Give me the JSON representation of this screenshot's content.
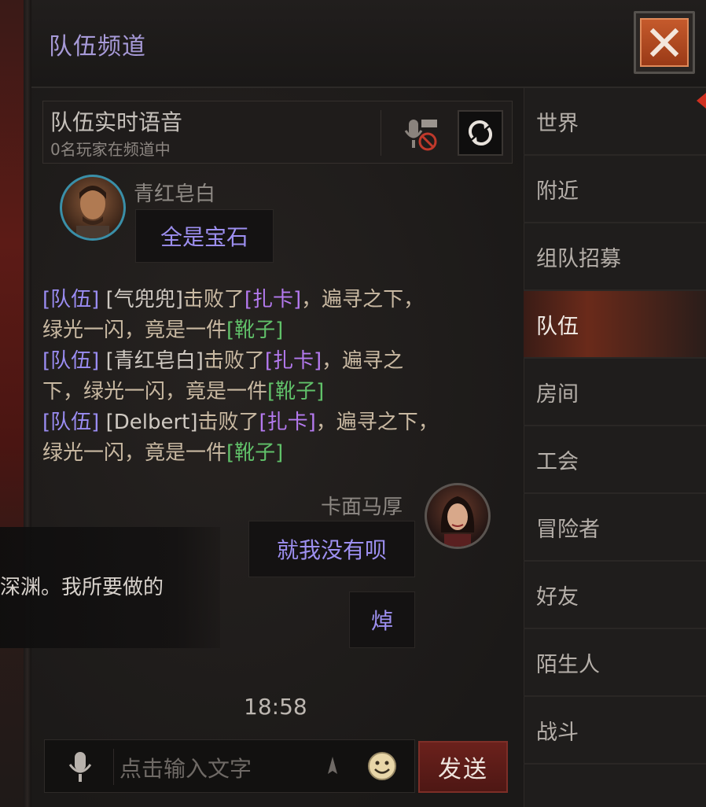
{
  "header": {
    "title": "队伍频道",
    "close_icon": "close-icon"
  },
  "voice": {
    "title": "队伍实时语音",
    "status": "0名玩家在频道中",
    "mic_icon": "mic-muted-icon",
    "refresh_icon": "refresh-icon"
  },
  "messages": {
    "left_player": {
      "name": "青红皂白",
      "text": "全是宝石"
    },
    "system": [
      {
        "channel": "[队伍]",
        "player": "[气兜兜]",
        "verb": "击败了",
        "target": "[扎卡]",
        "mid": "，遍寻之下，",
        "mid2": "绿光一闪，竟是一件",
        "item": "[靴子]"
      },
      {
        "channel": "[队伍]",
        "player": "[青红皂白]",
        "verb": "击败了",
        "target": "[扎卡]",
        "mid": "，遍寻之",
        "mid2": "下，绿光一闪，竟是一件",
        "item": "[靴子]"
      },
      {
        "channel": "[队伍]",
        "player": "[Delbert]",
        "verb": "击败了",
        "target": "[扎卡]",
        "mid": "，遍寻之下，",
        "mid2": "绿光一闪，竟是一件",
        "item": "[靴子]"
      }
    ],
    "right_player": {
      "name": "卡面马厚",
      "text1": "就我没有呗",
      "text2": "焯"
    },
    "popup_text": "深渊。我所要做的",
    "time": "18:58"
  },
  "input": {
    "placeholder": "点击输入文字",
    "send_label": "发送"
  },
  "tabs": [
    "世界",
    "附近",
    "组队招募",
    "队伍",
    "房间",
    "工会",
    "冒险者",
    "好友",
    "陌生人",
    "战斗"
  ],
  "active_tab": "队伍",
  "colors": {
    "accent_purple": "#9a8cf2",
    "item_purple": "#b57af0",
    "item_green": "#61c26a",
    "send_red": "#6b211c",
    "close_orange": "#c55a2c"
  }
}
